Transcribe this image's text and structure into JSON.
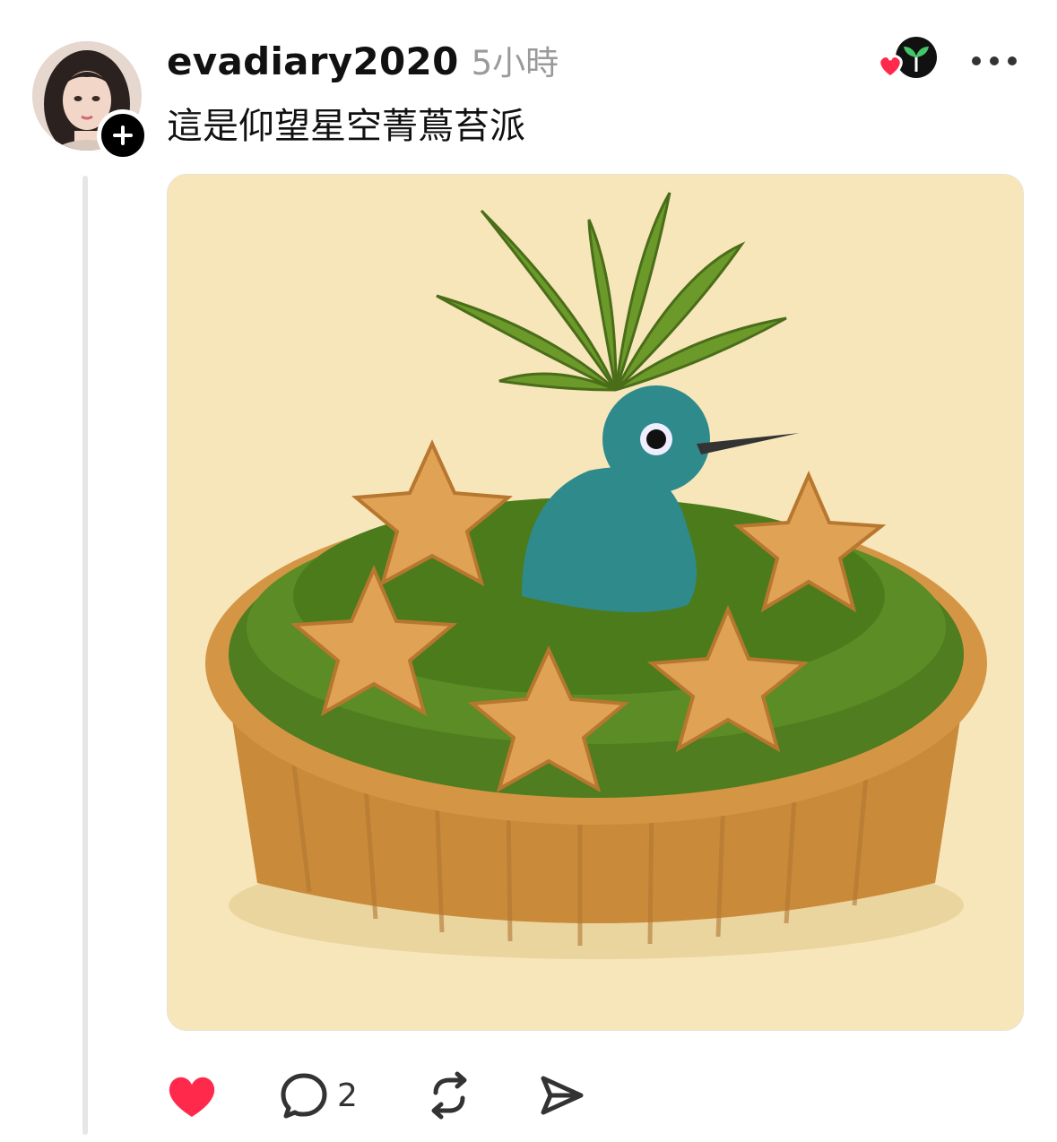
{
  "post": {
    "username": "evadiary2020",
    "time": "5小時",
    "text": "這是仰望星空菁蔦苔派",
    "follow_symbol": "+"
  },
  "actions": {
    "like_icon": "heart-filled-icon",
    "like_color": "#ff2a4b",
    "comment_icon": "speech-bubble-icon",
    "comment_count": "2",
    "repost_icon": "repost-icon",
    "share_icon": "send-icon"
  },
  "colors": {
    "background": "#f8e6bb",
    "moss": "#4f7d1f",
    "crust": "#d49645",
    "bird": "#2f8a8c",
    "leaf": "#6b9a2a"
  }
}
